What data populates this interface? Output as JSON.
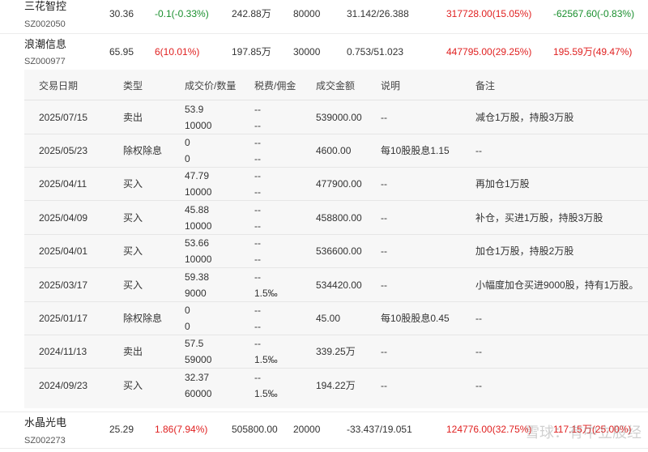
{
  "holdings_top": {
    "name": "三花智控",
    "code": "SZ002050",
    "price": "30.36",
    "change": "-0.1(-0.33%)",
    "market_value": "242.88万",
    "shares": "80000",
    "cost": "31.142/26.388",
    "float_pnl": "317728.00(15.05%)",
    "day_pnl": "-62567.60(-0.83%)"
  },
  "holding_expanded": {
    "name": "浪潮信息",
    "code": "SZ000977",
    "price": "65.95",
    "change": "6(10.01%)",
    "market_value": "197.85万",
    "shares": "30000",
    "cost": "0.753/51.023",
    "float_pnl": "447795.00(29.25%)",
    "day_pnl": "195.59万(49.47%)"
  },
  "detail_headers": [
    "交易日期",
    "类型",
    "成交价/数量",
    "税费/佣金",
    "成交金额",
    "说明",
    "备注"
  ],
  "transactions": [
    {
      "date": "2025/07/15",
      "type": "卖出",
      "price": "53.9",
      "qty": "10000",
      "tax": "--",
      "fee": "--",
      "amount": "539000.00",
      "desc": "--",
      "note": "减仓1万股，持股3万股"
    },
    {
      "date": "2025/05/23",
      "type": "除权除息",
      "price": "0",
      "qty": "0",
      "tax": "--",
      "fee": "--",
      "amount": "4600.00",
      "desc": "每10股股息1.15",
      "note": "--"
    },
    {
      "date": "2025/04/11",
      "type": "买入",
      "price": "47.79",
      "qty": "10000",
      "tax": "--",
      "fee": "--",
      "amount": "477900.00",
      "desc": "--",
      "note": "再加仓1万股"
    },
    {
      "date": "2025/04/09",
      "type": "买入",
      "price": "45.88",
      "qty": "10000",
      "tax": "--",
      "fee": "--",
      "amount": "458800.00",
      "desc": "--",
      "note": "补仓，买进1万股，持股3万股"
    },
    {
      "date": "2025/04/01",
      "type": "买入",
      "price": "53.66",
      "qty": "10000",
      "tax": "--",
      "fee": "--",
      "amount": "536600.00",
      "desc": "--",
      "note": "加仓1万股，持股2万股"
    },
    {
      "date": "2025/03/17",
      "type": "买入",
      "price": "59.38",
      "qty": "9000",
      "tax": "--",
      "fee": "1.5‰",
      "amount": "534420.00",
      "desc": "--",
      "note": "小幅度加仓买进9000股，持有1万股。"
    },
    {
      "date": "2025/01/17",
      "type": "除权除息",
      "price": "0",
      "qty": "0",
      "tax": "--",
      "fee": "--",
      "amount": "45.00",
      "desc": "每10股股息0.45",
      "note": "--"
    },
    {
      "date": "2024/11/13",
      "type": "卖出",
      "price": "57.5",
      "qty": "59000",
      "tax": "--",
      "fee": "1.5‰",
      "amount": "339.25万",
      "desc": "--",
      "note": "--"
    },
    {
      "date": "2024/09/23",
      "type": "买入",
      "price": "32.37",
      "qty": "60000",
      "tax": "--",
      "fee": "1.5‰",
      "amount": "194.22万",
      "desc": "--",
      "note": "--"
    }
  ],
  "holding_bottom": {
    "name": "水晶光电",
    "code": "SZ002273",
    "price": "25.29",
    "change": "1.86(7.94%)",
    "market_value": "505800.00",
    "shares": "20000",
    "cost": "-33.437/19.051",
    "float_pnl": "124776.00(32.75%)",
    "day_pnl": "117.15万(25.00%)"
  },
  "watermark": "雪球：有中立股经"
}
